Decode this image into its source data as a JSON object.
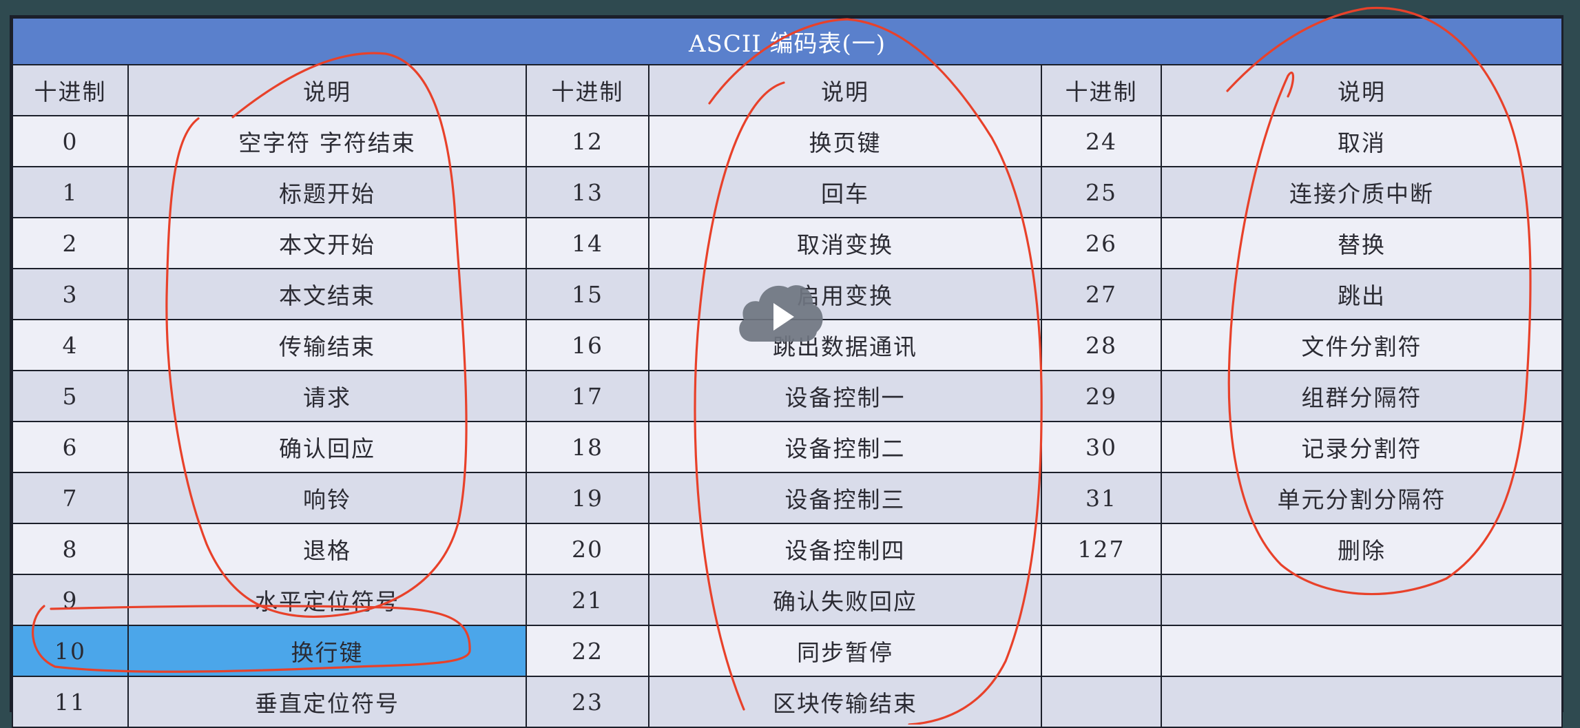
{
  "table": {
    "title": "ASCII 编码表(一)",
    "headers": [
      "十进制",
      "说明",
      "十进制",
      "说明",
      "十进制",
      "说明"
    ],
    "rows": [
      [
        "0",
        "空字符 字符结束",
        "12",
        "换页键",
        "24",
        "取消"
      ],
      [
        "1",
        "标题开始",
        "13",
        "回车",
        "25",
        "连接介质中断"
      ],
      [
        "2",
        "本文开始",
        "14",
        "取消变换",
        "26",
        "替换"
      ],
      [
        "3",
        "本文结束",
        "15",
        "启用变换",
        "27",
        "跳出"
      ],
      [
        "4",
        "传输结束",
        "16",
        "跳出数据通讯",
        "28",
        "文件分割符"
      ],
      [
        "5",
        "请求",
        "17",
        "设备控制一",
        "29",
        "组群分隔符"
      ],
      [
        "6",
        "确认回应",
        "18",
        "设备控制二",
        "30",
        "记录分割符"
      ],
      [
        "7",
        "响铃",
        "19",
        "设备控制三",
        "31",
        "单元分割分隔符"
      ],
      [
        "8",
        "退格",
        "20",
        "设备控制四",
        "127",
        "删除"
      ],
      [
        "9",
        "水平定位符号",
        "21",
        "确认失败回应",
        "",
        ""
      ],
      [
        "10",
        "换行键",
        "22",
        "同步暂停",
        "",
        ""
      ],
      [
        "11",
        "垂直定位符号",
        "23",
        "区块传输结束",
        "",
        ""
      ]
    ],
    "highlighted_row": 10
  },
  "colors": {
    "background": "#2f4a50",
    "title_bar": "#5a80cc",
    "row_light": "#eeeff7",
    "row_dark": "#d9dcea",
    "highlight": "#4ba6ea",
    "annotation": "#e8412a"
  },
  "overlay": {
    "play_icon": "play-icon"
  }
}
